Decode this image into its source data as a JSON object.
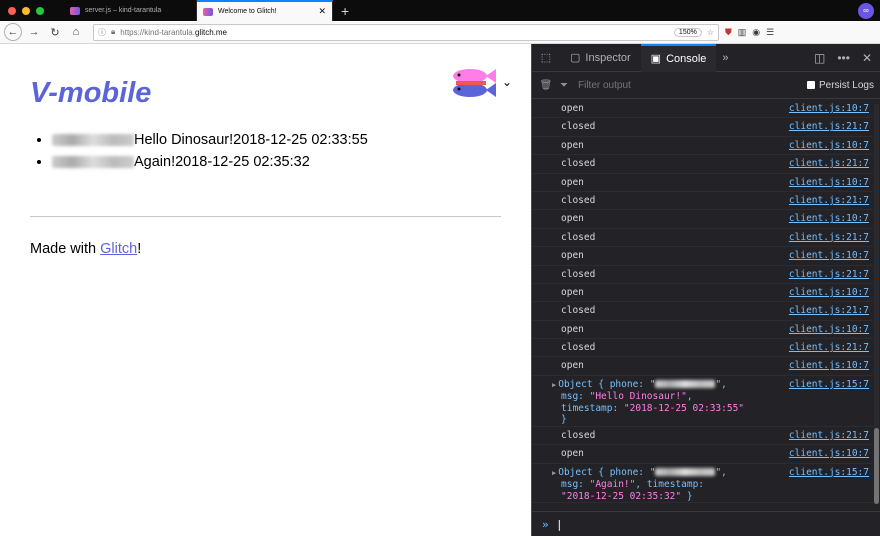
{
  "browser": {
    "tabs": [
      {
        "title": "server.js – kind-tarantula"
      },
      {
        "title": "Welcome to Glitch!"
      }
    ],
    "url_prefix": "https://",
    "url_host": "kind-tarantula.",
    "url_domain": "glitch.me",
    "zoom": "150%",
    "colors": {
      "accent": "#0a84ff",
      "traffic_red": "#fe5f57",
      "traffic_yellow": "#febc2e",
      "traffic_green": "#28c840"
    }
  },
  "page": {
    "title": "V-mobile",
    "messages": [
      {
        "text": "Hello Dinosaur!2018-12-25 02:33:55"
      },
      {
        "text": "Again!2018-12-25 02:35:32"
      }
    ],
    "made_prefix": "Made with ",
    "made_link": "Glitch",
    "made_suffix": "!"
  },
  "devtools": {
    "tabs": [
      {
        "label": "Inspector"
      },
      {
        "label": "Console"
      }
    ],
    "filter_placeholder": "Filter output",
    "persist_logs": "Persist Logs",
    "console": [
      {
        "text": "open",
        "src": "client.js:10:7"
      },
      {
        "text": "closed",
        "src": "client.js:21:7"
      },
      {
        "text": "open",
        "src": "client.js:10:7"
      },
      {
        "text": "closed",
        "src": "client.js:21:7"
      },
      {
        "text": "open",
        "src": "client.js:10:7"
      },
      {
        "text": "closed",
        "src": "client.js:21:7"
      },
      {
        "text": "open",
        "src": "client.js:10:7"
      },
      {
        "text": "closed",
        "src": "client.js:21:7"
      },
      {
        "text": "open",
        "src": "client.js:10:7"
      },
      {
        "text": "closed",
        "src": "client.js:21:7"
      },
      {
        "text": "open",
        "src": "client.js:10:7"
      },
      {
        "text": "closed",
        "src": "client.js:21:7"
      },
      {
        "text": "open",
        "src": "client.js:10:7"
      },
      {
        "text": "closed",
        "src": "client.js:21:7"
      },
      {
        "text": "open",
        "src": "client.js:10:7"
      }
    ],
    "object1": {
      "l1": "Object { phone: \"",
      "l1b": "\",",
      "l2a": "msg: ",
      "l2b": "\"Hello Dinosaur!\"",
      "l2c": ",",
      "l3a": "timestamp: ",
      "l3b": "\"2018-12-25 02:33:55\"",
      "l4": "}",
      "src": "client.js:15:7"
    },
    "console2": [
      {
        "text": "closed",
        "src": "client.js:21:7"
      },
      {
        "text": "open",
        "src": "client.js:10:7"
      }
    ],
    "object2": {
      "l1": "Object { phone: \"",
      "l1b": "\",",
      "l2a": "msg: ",
      "l2b": "\"Again!\"",
      "l2c": ", timestamp:",
      "l3b": "\"2018-12-25 02:35:32\"",
      "l3c": " }",
      "src": "client.js:15:7"
    },
    "prompt": "»",
    "colors": {
      "panel": "#232327",
      "link": "#75bfff",
      "string": "#ff7de9"
    }
  }
}
